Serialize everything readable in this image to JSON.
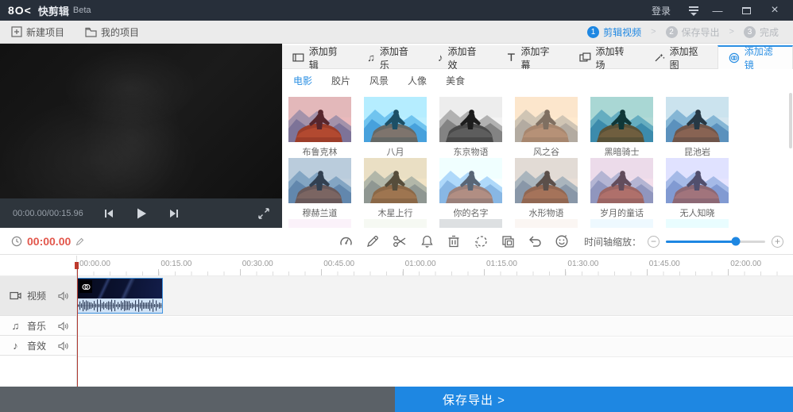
{
  "app": {
    "logo": "8O<",
    "title": "快剪辑",
    "beta": "Beta"
  },
  "titlebar": {
    "login": "登录",
    "minimize": "—",
    "close": "×"
  },
  "toolbar": {
    "new_project": "新建项目",
    "my_projects": "我的项目",
    "steps": [
      {
        "num": "1",
        "label": "剪辑视频",
        "active": true
      },
      {
        "num": "2",
        "label": "保存导出",
        "active": false
      },
      {
        "num": "3",
        "label": "完成",
        "active": false
      }
    ]
  },
  "preview": {
    "time": "00:00.00/00:15.96"
  },
  "panel": {
    "tabs": [
      {
        "icon": "clip-icon",
        "label": "添加剪辑",
        "active": false
      },
      {
        "icon": "music-icon",
        "label": "添加音乐",
        "active": false
      },
      {
        "icon": "sfx-icon",
        "label": "添加音效",
        "active": false
      },
      {
        "icon": "subtitle-icon",
        "label": "添加字幕",
        "active": false
      },
      {
        "icon": "transition-icon",
        "label": "添加转场",
        "active": false
      },
      {
        "icon": "matting-icon",
        "label": "添加抠图",
        "active": false
      },
      {
        "icon": "filter-icon",
        "label": "添加滤镜",
        "active": true
      }
    ],
    "subtabs": [
      {
        "label": "电影",
        "active": true
      },
      {
        "label": "胶片",
        "active": false
      },
      {
        "label": "风景",
        "active": false
      },
      {
        "label": "人像",
        "active": false
      },
      {
        "label": "美食",
        "active": false
      }
    ],
    "filters": [
      {
        "name": "布鲁克林",
        "overlay": "rgba(205,60,50,0.28)",
        "css": "saturate(1.35)"
      },
      {
        "name": "八月",
        "overlay": "rgba(60,190,230,0.25)",
        "css": "saturate(1.3) brightness(1.05)"
      },
      {
        "name": "东京物语",
        "overlay": "rgba(0,0,0,0)",
        "css": "grayscale(1) contrast(1.05)"
      },
      {
        "name": "风之谷",
        "overlay": "rgba(225,180,165,0.45)",
        "css": "sepia(0.45)"
      },
      {
        "name": "黑暗骑士",
        "overlay": "rgba(40,130,105,0.28)",
        "css": "saturate(1.25) contrast(1.1)"
      },
      {
        "name": "昆池岩",
        "overlay": "rgba(110,190,210,0.15)",
        "css": "saturate(1.1)"
      },
      {
        "name": "穆赫兰道",
        "overlay": "rgba(95,135,175,0.3)",
        "css": "saturate(0.9)"
      },
      {
        "name": "木星上行",
        "overlay": "rgba(205,165,85,0.3)",
        "css": "sepia(0.25)"
      },
      {
        "name": "你的名字",
        "overlay": "rgba(200,225,245,0.3)",
        "css": "brightness(1.12) saturate(1.1)"
      },
      {
        "name": "水形物语",
        "overlay": "rgba(235,185,145,0.3)",
        "css": "saturate(0.95)"
      },
      {
        "name": "岁月的童话",
        "overlay": "rgba(230,155,185,0.32)",
        "css": "brightness(1.05)"
      },
      {
        "name": "无人知晓",
        "overlay": "rgba(175,155,225,0.32)",
        "css": "brightness(1.08)"
      },
      {
        "name": "",
        "overlay": "rgba(235,200,205,0.4)",
        "css": "brightness(1.1)"
      },
      {
        "name": "",
        "overlay": "rgba(225,215,190,0.4)",
        "css": "brightness(1.1)"
      },
      {
        "name": "",
        "overlay": "rgba(210,210,210,0.4)",
        "css": "grayscale(0.5)"
      },
      {
        "name": "",
        "overlay": "rgba(235,210,190,0.4)",
        "css": "brightness(1.1)"
      },
      {
        "name": "",
        "overlay": "rgba(205,215,225,0.4)",
        "css": "brightness(1.1)"
      },
      {
        "name": "",
        "overlay": "rgba(195,225,220,0.4)",
        "css": "brightness(1.1)"
      }
    ]
  },
  "timeline": {
    "current_time": "00:00.00",
    "tools": [
      "speed-icon",
      "pencil-icon",
      "scissors-icon",
      "bell-icon",
      "trash-icon",
      "magic-lasso-icon",
      "copy-icon",
      "undo-icon",
      "emoji-icon"
    ],
    "zoom_label": "时间轴缩放：",
    "zoom_percent": 70,
    "ruler": [
      "00:00.00",
      "00:15.00",
      "00:30.00",
      "00:45.00",
      "01:00.00",
      "01:15.00",
      "01:30.00",
      "01:45.00",
      "02:00.00"
    ],
    "tracks": [
      {
        "icon": "video-track-icon",
        "label": "视频"
      },
      {
        "icon": "music-track-icon",
        "label": "音乐"
      },
      {
        "icon": "sfx-track-icon",
        "label": "音效"
      }
    ]
  },
  "footer": {
    "export_label": "保存导出 >"
  },
  "colors": {
    "accent": "#1e87e2",
    "titlebar": "#272f3a",
    "time_red": "#e2574c",
    "footer_gray": "#5b6167"
  }
}
